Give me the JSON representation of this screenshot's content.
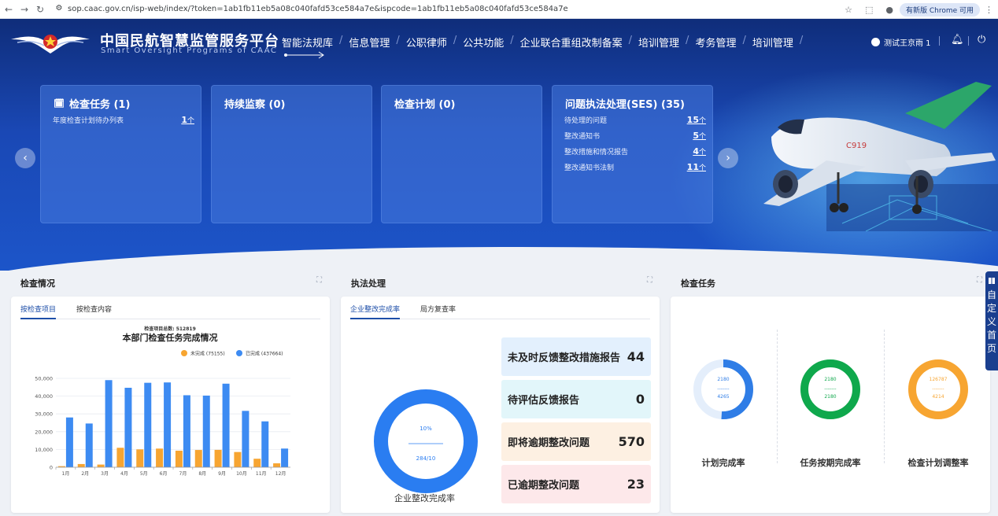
{
  "browser": {
    "url": "sop.caac.gov.cn/isp-web/index/?token=1ab1fb11eb5a08c040fafd53ce584a7e&ispcode=1ab1fb11eb5a08c040fafd53ce584a7e",
    "update_label": "有新版 Chrome 可用"
  },
  "header": {
    "brand_cn": "中国民航智慧监管服务平台",
    "brand_en": "Smart Oversight Programs of CAAC",
    "nav": [
      "智能法规库",
      "信息管理",
      "公职律师",
      "公共功能",
      "企业联合重组改制备案",
      "培训管理",
      "考务管理",
      "培训管理"
    ],
    "user": "测试王京雨 1"
  },
  "cards": {
    "inspection": {
      "title": "检查任务 (1)",
      "rows": [
        {
          "label": "年度检查计划待办列表",
          "value": "1",
          "unit": "个"
        }
      ]
    },
    "monitoring": {
      "title": "持续监察 (0)"
    },
    "plan": {
      "title": "检查计划 (0)"
    },
    "ses": {
      "title": "问题执法处理(SES) (35)",
      "rows": [
        {
          "label": "待处理的问题",
          "value": "15",
          "unit": "个"
        },
        {
          "label": "整改通知书",
          "value": "5",
          "unit": "个"
        },
        {
          "label": "整改措施和情况报告",
          "value": "4",
          "unit": "个"
        },
        {
          "label": "整改通知书法制",
          "value": "11",
          "unit": "个"
        }
      ]
    }
  },
  "sections": {
    "check": {
      "title": "检查情况",
      "tabs": [
        "按检查项目",
        "按检查内容"
      ]
    },
    "enforce": {
      "title": "执法处理",
      "tabs": [
        "企业整改完成率",
        "局方复查率"
      ],
      "donut_top": "10%",
      "donut_bottom": "284/10",
      "donut_caption": "企业整改完成率",
      "stats": [
        {
          "label": "未及时反馈整改措施报告",
          "value": "44",
          "bg": "#e3f0fd"
        },
        {
          "label": "待评估反馈报告",
          "value": "0",
          "bg": "#e2f6fa"
        },
        {
          "label": "即将逾期整改问题",
          "value": "570",
          "bg": "#fdf0e2"
        },
        {
          "label": "已逾期整改问题",
          "value": "23",
          "bg": "#fde8ea"
        }
      ]
    },
    "tasks": {
      "title": "检查任务",
      "gauges": [
        {
          "label": "计划完成率",
          "top": "2180",
          "bottom": "4265",
          "color": "#2f7de6",
          "track": "#e4eefb",
          "fraction": 0.51
        },
        {
          "label": "任务按期完成率",
          "top": "2180",
          "bottom": "2180",
          "color": "#0fa84c",
          "track": "#e6f6ec",
          "fraction": 1.0
        },
        {
          "label": "检查计划调整率",
          "top": "126787",
          "bottom": "4214",
          "color": "#f7a531",
          "track": "#fdf1df",
          "fraction": 1.0
        }
      ]
    }
  },
  "side_tab": "自定义首页",
  "chart_data": {
    "type": "bar",
    "supertitle": "检查项目总数: 512819",
    "title": "本部门检查任务完成情况",
    "legend": [
      {
        "name": "未完成 (75155)",
        "color": "#f7a531"
      },
      {
        "name": "已完成 (437664)",
        "color": "#3d8bf2"
      }
    ],
    "categories": [
      "1月",
      "2月",
      "3月",
      "4月",
      "5月",
      "6月",
      "7月",
      "8月",
      "9月",
      "10月",
      "11月",
      "12月"
    ],
    "series": [
      {
        "name": "未完成",
        "color": "#f7a531",
        "values": [
          600,
          1800,
          1500,
          10948,
          10043,
          10488,
          9310,
          9708,
          9769,
          8558,
          4779,
          2200
        ]
      },
      {
        "name": "已完成",
        "color": "#3d8bf2",
        "values": [
          28000,
          24600,
          49000,
          44700,
          47500,
          47700,
          40500,
          40300,
          47000,
          31700,
          25800,
          10500
        ]
      }
    ],
    "yticks": [
      "0",
      "10,000",
      "20,000",
      "30,000",
      "40,000",
      "50,000"
    ],
    "ylim": [
      0,
      50000
    ],
    "grid": true,
    "legend_position": "top-right"
  }
}
